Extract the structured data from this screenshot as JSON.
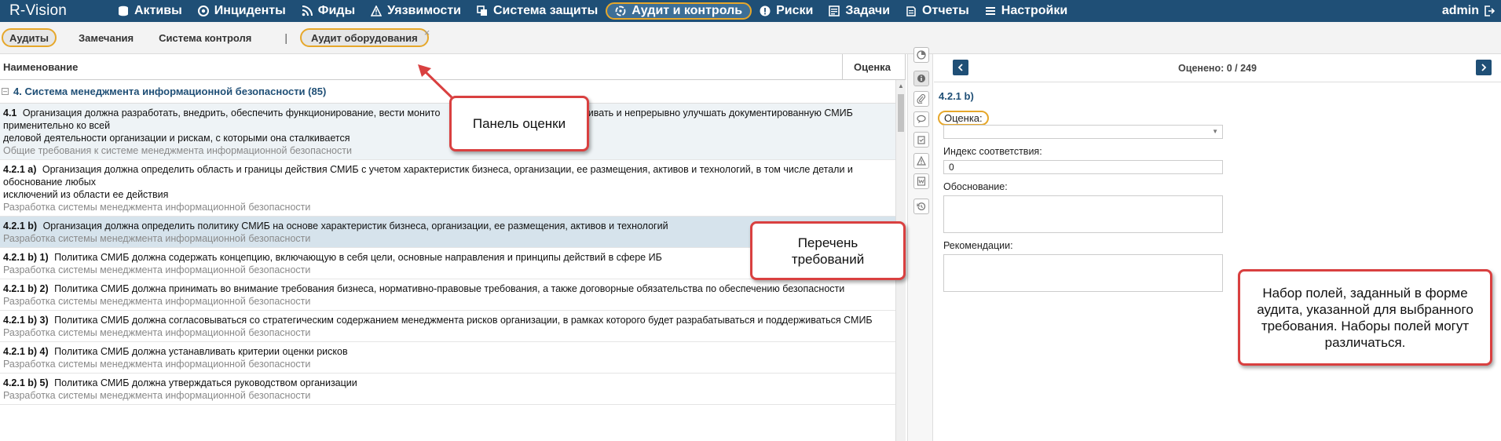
{
  "app": {
    "logo": "R-Vision",
    "user": "admin"
  },
  "nav": [
    {
      "label": "Активы",
      "icon": "database-icon"
    },
    {
      "label": "Инциденты",
      "icon": "target-icon"
    },
    {
      "label": "Фиды",
      "icon": "rss-icon"
    },
    {
      "label": "Уязвимости",
      "icon": "warning-icon"
    },
    {
      "label": "Система защиты",
      "icon": "layers-icon"
    },
    {
      "label": "Аудит и контроль",
      "icon": "audit-icon",
      "active": true
    },
    {
      "label": "Риски",
      "icon": "exclamation-icon"
    },
    {
      "label": "Задачи",
      "icon": "tasks-icon"
    },
    {
      "label": "Отчеты",
      "icon": "reports-icon"
    },
    {
      "label": "Настройки",
      "icon": "menu-icon"
    }
  ],
  "subtabs": {
    "audits": "Аудиты",
    "remarks": "Замечания",
    "control": "Система контроля",
    "separator": "|",
    "equipment": "Аудит оборудования",
    "close": "×"
  },
  "list": {
    "col_name": "Наименование",
    "col_score": "Оценка",
    "group": "4. Система менеджмента информационной безопасности (85)",
    "rows": [
      {
        "code": "4.1",
        "text": "Организация должна разработать, внедрить, обеспечить функционирование, вести монито",
        "text2": "деловой деятельности организации и рискам, с которыми она сталкивается",
        "tail": "живать и непрерывно улучшать документированную СМИБ применительно ко всей",
        "desc": "Общие требования к системе менеджмента информационной безопасности"
      },
      {
        "code": "4.2.1 a)",
        "text": "Организация должна определить область и границы действия СМИБ с учетом характеристик бизнеса, организации, ее размещения, активов и технологий, в том числе детали и обоснование любых",
        "text2": "исключений из области ее действия",
        "desc": "Разработка системы менеджмента информационной безопасности"
      },
      {
        "code": "4.2.1 b)",
        "text": "Организация должна определить политику СМИБ на основе характеристик бизнеса, организации, ее размещения, активов и технологий",
        "desc": "Разработка системы менеджмента информационной безопасности"
      },
      {
        "code": "4.2.1 b) 1)",
        "text": "Политика СМИБ должна содержать концепцию, включающую в себя цели, основные направления и принципы действий в сфере ИБ",
        "desc": "Разработка системы менеджмента информационной безопасности"
      },
      {
        "code": "4.2.1 b) 2)",
        "text": "Политика СМИБ должна принимать во внимание требования бизнеса, нормативно-правовые требования, а также договорные обязательства по обеспечению безопасности",
        "desc": "Разработка системы менеджмента информационной безопасности"
      },
      {
        "code": "4.2.1 b) 3)",
        "text": "Политика СМИБ должна согласовываться со стратегическим содержанием менеджмента рисков организации, в рамках которого будет разрабатываться и поддерживаться СМИБ",
        "desc": "Разработка системы менеджмента информационной безопасности"
      },
      {
        "code": "4.2.1 b) 4)",
        "text": "Политика СМИБ должна устанавливать критерии оценки рисков",
        "desc": "Разработка системы менеджмента информационной безопасности"
      },
      {
        "code": "4.2.1 b) 5)",
        "text": "Политика СМИБ должна утверждаться руководством организации",
        "desc": "Разработка системы менеджмента информационной безопасности"
      }
    ]
  },
  "panel": {
    "counter": "Оценено: 0 / 249",
    "req_id": "4.2.1 b)",
    "score_label": "Оценка:",
    "index_label": "Индекс соответствия:",
    "index_value": "0",
    "reason_label": "Обоснование:",
    "recommend_label": "Рекомендации:"
  },
  "callouts": {
    "panel": "Панель оценки",
    "list": "Перечень требований",
    "fields": "Набор полей, заданный в форме аудита, указанной для выбранного требования. Наборы полей могут различаться."
  },
  "colors": {
    "nav_bg": "#1f4f76",
    "highlight": "#e6a72a",
    "callout_border": "#d94040",
    "selected_row": "#d6e3ec"
  }
}
